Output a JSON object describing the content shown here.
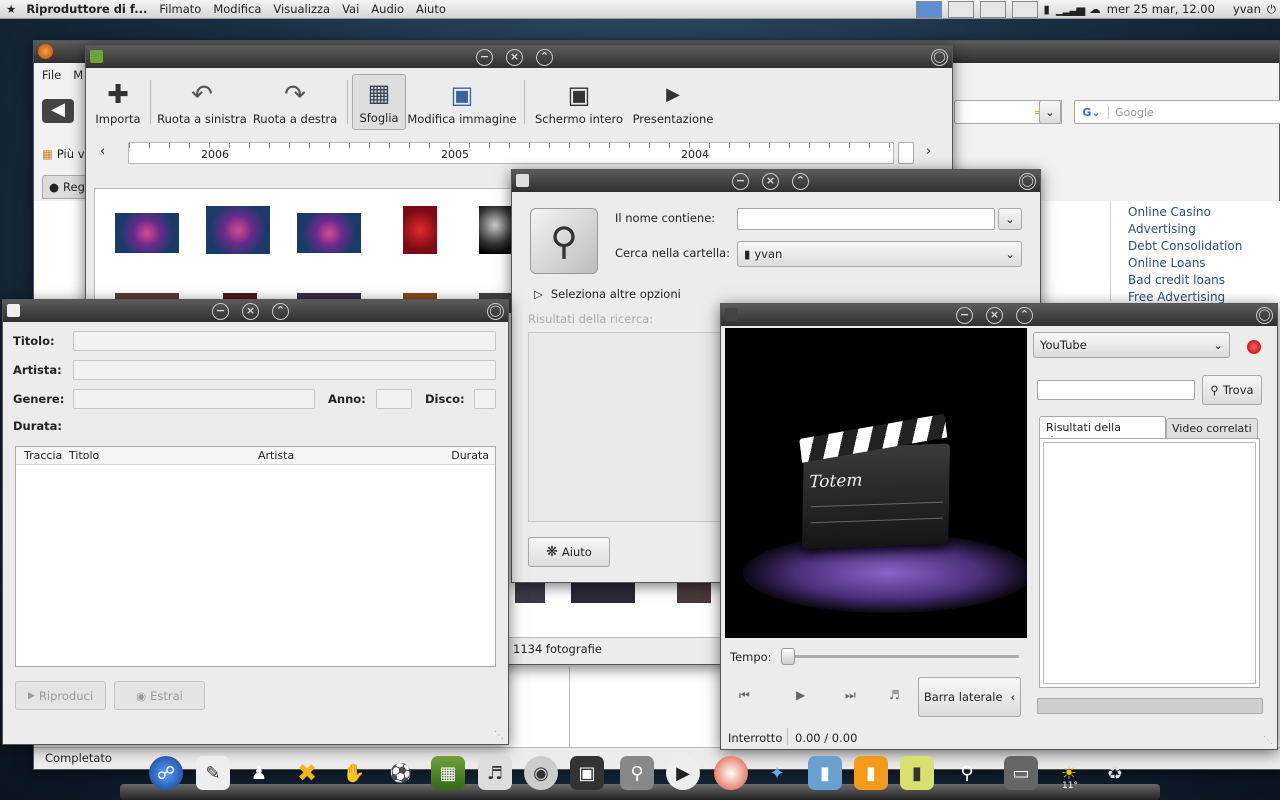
{
  "panel": {
    "app": "Riproduttore di f...",
    "menu": [
      "Filmato",
      "Modifica",
      "Visualizza",
      "Vai",
      "Audio",
      "Aiuto"
    ],
    "clock": "mer 25 mar, 12.00",
    "user": "yvan"
  },
  "firefox": {
    "menu": [
      "File",
      "M"
    ],
    "bookmark": "Più vi",
    "tab": "Reg",
    "search_placeholder": "Google",
    "status": "Completato",
    "ads": [
      "Online Casino",
      "Advertising",
      "Debt Consolidation",
      "Online Loans",
      "Bad credit loans",
      "Free Advertising"
    ]
  },
  "fspot": {
    "toolbar": [
      {
        "label": "Importa",
        "icon": "import-icon"
      },
      {
        "label": "Ruota a sinistra",
        "icon": "rotate-left-icon"
      },
      {
        "label": "Ruota a destra",
        "icon": "rotate-right-icon"
      },
      {
        "label": "Sfoglia",
        "icon": "browse-icon"
      },
      {
        "label": "Modifica immagine",
        "icon": "edit-image-icon"
      },
      {
        "label": "Schermo intero",
        "icon": "fullscreen-icon"
      },
      {
        "label": "Presentazione",
        "icon": "slideshow-icon"
      }
    ],
    "years": [
      "2006",
      "2005",
      "2004"
    ],
    "count": "1134 fotografie"
  },
  "search": {
    "name_label": "Il nome contiene:",
    "folder_label": "Cerca nella cartella:",
    "folder_value": "yvan",
    "more_options": "Seleziona altre opzioni",
    "results_label": "Risultati della ricerca:",
    "help": "Aiuto"
  },
  "ripper": {
    "title_label": "Titolo:",
    "artist_label": "Artista:",
    "genre_label": "Genere:",
    "year_label": "Anno:",
    "disc_label": "Disco:",
    "duration_label": "Durata:",
    "columns": [
      "Traccia",
      "Titolo",
      "Artista",
      "Durata"
    ],
    "play": "Riproduci",
    "extract": "Estrai"
  },
  "totem": {
    "logo_text": "Totem",
    "source": "YouTube",
    "find": "Trova",
    "tabs": [
      "Risultati della ricerca",
      "Video correlati"
    ],
    "time_label": "Tempo:",
    "sidebar_toggle": "Barra laterale",
    "status": "Interrotto",
    "time": "0.00 / 0.00"
  },
  "dock": {
    "weather_temp": "11°"
  },
  "colors": {
    "accent": "#5d8fcf",
    "titlebar": "#3a3a3a",
    "purple_glow": "#8a63c7"
  }
}
